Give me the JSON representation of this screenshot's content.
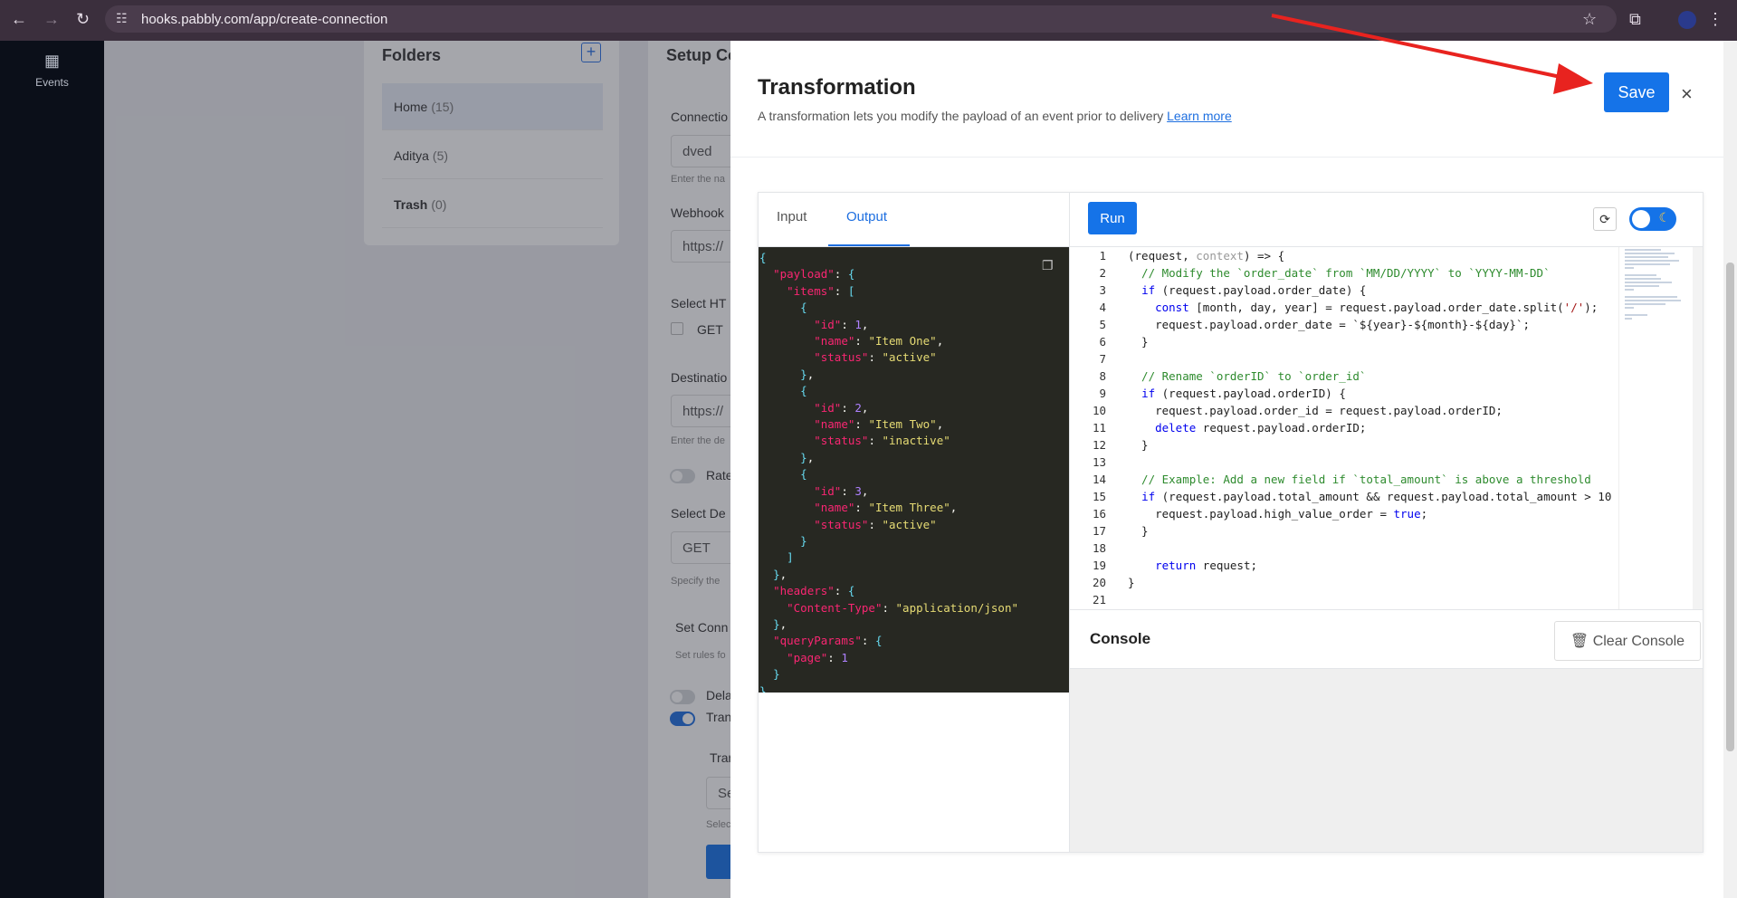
{
  "browser": {
    "url": "hooks.pabbly.com/app/create-connection"
  },
  "sidebar": {
    "events_label": "Events"
  },
  "folders": {
    "title": "Folders",
    "items": [
      {
        "label": "Home",
        "count": "(15)"
      },
      {
        "label": "Aditya",
        "count": "(5)"
      },
      {
        "label": "Trash",
        "count": "(0)"
      }
    ]
  },
  "setup": {
    "title": "Setup Co",
    "connection_label": "Connectio",
    "connection_value": "dved",
    "connection_help": "Enter the na",
    "webhook_label": "Webhook",
    "webhook_value": "https://",
    "select_http_label": "Select HT",
    "get_label": "GET",
    "destination_label": "Destinatio",
    "destination_value": "https://",
    "destination_help": "Enter the de",
    "rate_label": "Rate",
    "select_dest_label": "Select De",
    "select_dest_value": "GET",
    "specify_help": "Specify the",
    "set_conn_label": "Set Conn",
    "set_rules_help": "Set rules fo",
    "delay_label": "Dela",
    "transform_label": "Tran",
    "transform_sub_label": "Tran",
    "transform_input_value": "Se",
    "select_help": "Selec"
  },
  "modal": {
    "title": "Transformation",
    "description": "A transformation lets you modify the payload of an event prior to delivery",
    "learn_more": "Learn more",
    "save_label": "Save",
    "close_glyph": "×",
    "tabs": [
      "Input",
      "Output"
    ],
    "active_tab": "Output",
    "run_label": "Run",
    "console_label": "Console",
    "clear_console_label": "Clear Console"
  },
  "output_json": {
    "payload": {
      "items": [
        {
          "id": 1,
          "name": "Item One",
          "status": "active"
        },
        {
          "id": 2,
          "name": "Item Two",
          "status": "inactive"
        },
        {
          "id": 3,
          "name": "Item Three",
          "status": "active"
        }
      ]
    },
    "headers": {
      "Content-Type": "application/json"
    },
    "queryParams": {
      "page": 1
    }
  },
  "editor": {
    "line_numbers": [
      "1",
      "2",
      "3",
      "4",
      "5",
      "6",
      "7",
      "8",
      "9",
      "10",
      "11",
      "12",
      "13",
      "14",
      "15",
      "16",
      "17",
      "18",
      "19",
      "20",
      "21"
    ],
    "code_lines": [
      "(request, context) => {",
      "  // Modify the `order_date` from `MM/DD/YYYY` to `YYYY-MM-DD`",
      "  if (request.payload.order_date) {",
      "    const [month, day, year] = request.payload.order_date.split('/');",
      "    request.payload.order_date = `${year}-${month}-${day}`;",
      "  }",
      "",
      "  // Rename `orderID` to `order_id`",
      "  if (request.payload.orderID) {",
      "    request.payload.order_id = request.payload.orderID;",
      "    delete request.payload.orderID;",
      "  }",
      "",
      "  // Example: Add a new field if `total_amount` is above a threshold",
      "  if (request.payload.total_amount && request.payload.total_amount > 10",
      "    request.payload.high_value_order = true;",
      "  }",
      "",
      "    return request;",
      "}",
      ""
    ]
  },
  "colors": {
    "accent": "#1573e8",
    "annotation_arrow": "#e8231f",
    "json_bg": "#272822"
  }
}
